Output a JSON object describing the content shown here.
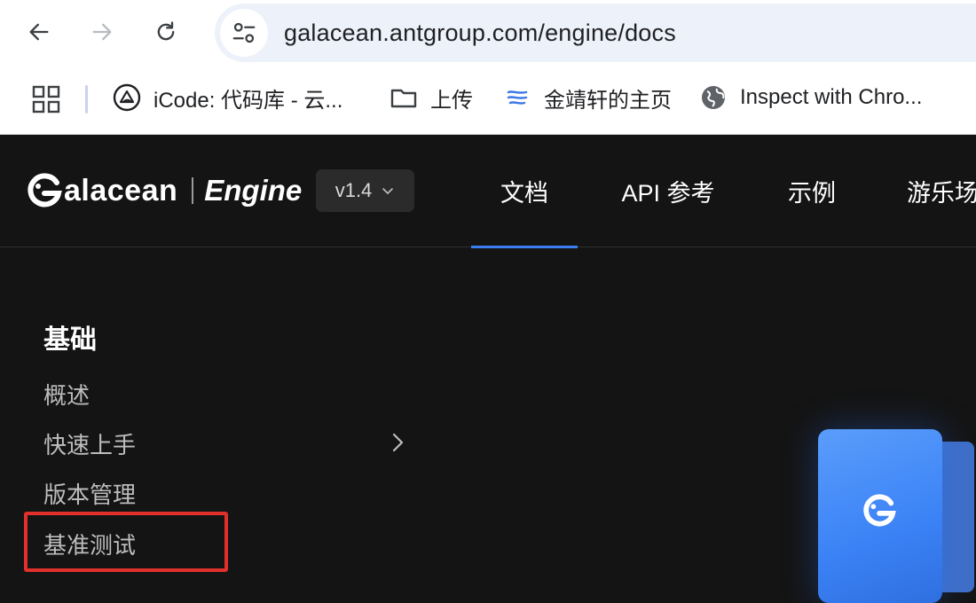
{
  "browser": {
    "url": "galacean.antgroup.com/engine/docs",
    "bookmarks": [
      {
        "label": "iCode: 代码库 - 云...",
        "icon": "icode-icon"
      },
      {
        "label": "上传",
        "icon": "folder-icon"
      },
      {
        "label": "金靖轩的主页",
        "icon": "stream-icon"
      },
      {
        "label": "Inspect with Chro...",
        "icon": "globe-icon"
      }
    ]
  },
  "site": {
    "logo_word": "alacean",
    "logo_engine": "Engine",
    "version": "v1.4",
    "nav": [
      {
        "label": "文档",
        "active": true
      },
      {
        "label": "API 参考",
        "active": false
      },
      {
        "label": "示例",
        "active": false
      },
      {
        "label": "游乐场",
        "active": false
      }
    ]
  },
  "sidebar": {
    "heading": "基础",
    "items": [
      {
        "label": "概述"
      },
      {
        "label": "快速上手",
        "expandable": true
      },
      {
        "label": "版本管理"
      },
      {
        "label": "基准测试",
        "highlighted": true
      }
    ]
  },
  "colors": {
    "accent": "#3a7ef2",
    "highlight_box": "#e1302b",
    "page_bg": "#141414"
  }
}
